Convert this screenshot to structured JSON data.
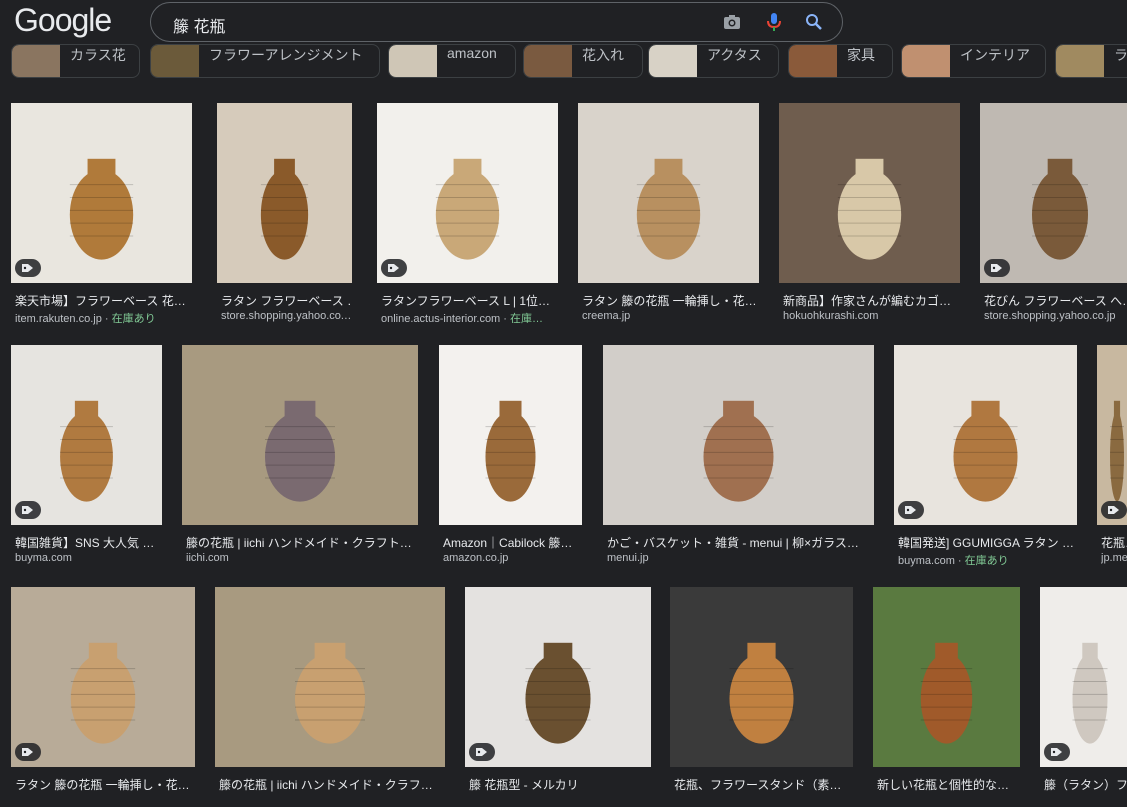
{
  "header": {
    "logo": "Google",
    "query": "籐 花瓶"
  },
  "chips": [
    {
      "label": "カラス花",
      "thumb": "#8a7560"
    },
    {
      "label": "フラワーアレンジメント",
      "thumb": "#6b5a3a"
    },
    {
      "label": "amazon",
      "thumb": "#cfc6b6"
    },
    {
      "label": "花入れ",
      "thumb": "#7a5a40"
    },
    {
      "label": "アクタス",
      "thumb": "#d8d2c6"
    },
    {
      "label": "家具",
      "thumb": "#8a5a3a"
    },
    {
      "label": "インテリア",
      "thumb": "#c09070"
    },
    {
      "label": "ラ",
      "thumb": "#a08a60"
    }
  ],
  "rows": [
    [
      {
        "title": "楽天市場】フラワーベース 花…",
        "source": "item.rakuten.co.jp",
        "stock": "在庫あり",
        "bg": "#e9e6df",
        "fg": "#b07a3a",
        "tag": true
      },
      {
        "title": "ラタン フラワーベース …",
        "source": "store.shopping.yahoo.co.…",
        "stock": "",
        "bg": "#d6cbbb",
        "fg": "#8a5a2a",
        "tag": false
      },
      {
        "title": "ラタンフラワーベース L | 1位…",
        "source": "online.actus-interior.com",
        "stock": "在庫…",
        "bg": "#f2f0ec",
        "fg": "#c9a878",
        "tag": true
      },
      {
        "title": "ラタン 籐の花瓶 一輪挿し・花…",
        "source": "creema.jp",
        "stock": "",
        "bg": "#d9d3cb",
        "fg": "#b89060",
        "tag": false
      },
      {
        "title": "新商品】作家さんが編むカゴ…",
        "source": "hokuohkurashi.com",
        "stock": "",
        "bg": "#6f5d4e",
        "fg": "#d8c8a8",
        "tag": false
      },
      {
        "title": "花びん フラワーベース へ…",
        "source": "store.shopping.yahoo.co.jp",
        "stock": "",
        "bg": "#bfb9b2",
        "fg": "#7a5a3a",
        "tag": true
      }
    ],
    [
      {
        "title": "韓国雑貨】SNS 大人気 …",
        "source": "buyma.com",
        "stock": "",
        "bg": "#e6e4e0",
        "fg": "#b07a40",
        "tag": true
      },
      {
        "title": "籐の花瓶 | iichi ハンドメイド・クラフト…",
        "source": "iichi.com",
        "stock": "",
        "bg": "#a89a80",
        "fg": "#7a6a70",
        "tag": false
      },
      {
        "title": "Amazon｜Cabilock 籐…",
        "source": "amazon.co.jp",
        "stock": "",
        "bg": "#f3f1ee",
        "fg": "#9a6a3a",
        "tag": false
      },
      {
        "title": "かご・バスケット・雑貨 - menui | 柳×ガラス…",
        "source": "menui.jp",
        "stock": "",
        "bg": "#d2cec9",
        "fg": "#a07050",
        "tag": false
      },
      {
        "title": "韓国発送] GGUMIGGA ラタン …",
        "source": "buyma.com",
        "stock": "在庫あり",
        "bg": "#e8e4de",
        "fg": "#b07840",
        "tag": true
      },
      {
        "title": "花瓶…",
        "source": "jp.me…",
        "stock": "",
        "bg": "#c8b8a0",
        "fg": "#8a6a40",
        "tag": true
      }
    ],
    [
      {
        "title": "ラタン 籐の花瓶 一輪挿し・花…",
        "source": "",
        "stock": "",
        "bg": "#b8ab98",
        "fg": "#c8a070",
        "tag": true
      },
      {
        "title": "籐の花瓶 | iichi ハンドメイド・クラフ…",
        "source": "",
        "stock": "",
        "bg": "#a89a80",
        "fg": "#c8a070",
        "tag": false
      },
      {
        "title": "籐 花瓶型 - メルカリ",
        "source": "",
        "stock": "",
        "bg": "#e4e2e0",
        "fg": "#6a5030",
        "tag": true
      },
      {
        "title": "花瓶、フラワースタンド（素…",
        "source": "",
        "stock": "",
        "bg": "#3a3a3a",
        "fg": "#c08040",
        "tag": false
      },
      {
        "title": "新しい花瓶と個性的な…",
        "source": "",
        "stock": "",
        "bg": "#5a7a40",
        "fg": "#a05a2a",
        "tag": false
      },
      {
        "title": "籐（ラタン）フ…",
        "source": "",
        "stock": "",
        "bg": "#efedea",
        "fg": "#cfc8c0",
        "tag": true
      }
    ]
  ]
}
